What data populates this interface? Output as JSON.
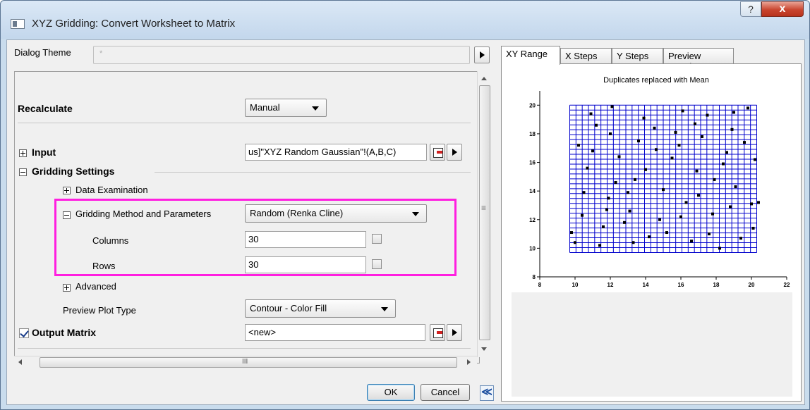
{
  "window": {
    "title": "XYZ Gridding: Convert Worksheet to Matrix",
    "help_label": "?",
    "close_label": "x"
  },
  "dialog_theme": {
    "label": "Dialog Theme",
    "value": "*"
  },
  "settings": {
    "recalculate": {
      "label": "Recalculate",
      "value": "Manual"
    },
    "input": {
      "label": "Input",
      "value": "us]\"XYZ Random Gaussian\"!(A,B,C)"
    },
    "gridding_settings": {
      "label": "Gridding Settings"
    },
    "data_examination": {
      "label": "Data Examination"
    },
    "gridding_method": {
      "label": "Gridding Method and Parameters",
      "value": "Random (Renka Cline)"
    },
    "columns": {
      "label": "Columns",
      "value": "30"
    },
    "rows": {
      "label": "Rows",
      "value": "30"
    },
    "advanced": {
      "label": "Advanced"
    },
    "preview_plot_type": {
      "label": "Preview Plot Type",
      "value": "Contour - Color Fill"
    },
    "output_matrix": {
      "label": "Output Matrix",
      "value": "<new>",
      "checked": true
    }
  },
  "scroll": {
    "h_thumb_glyph": "III",
    "v_thumb_glyph": "≡"
  },
  "buttons": {
    "ok": "OK",
    "cancel": "Cancel",
    "collapse": "≪"
  },
  "tabs": [
    "XY Range",
    "X Steps",
    "Y Steps",
    "Preview Result"
  ],
  "chart_data": {
    "type": "scatter",
    "title": "Duplicates replaced with Mean",
    "xlim": [
      8,
      22
    ],
    "ylim": [
      8,
      21
    ],
    "x_ticks": [
      8,
      10,
      12,
      14,
      16,
      18,
      20,
      22
    ],
    "y_ticks": [
      8,
      10,
      12,
      14,
      16,
      18,
      20
    ],
    "grid": {
      "x_from": 9.7,
      "x_to": 20.3,
      "y_from": 9.7,
      "y_to": 20.0,
      "columns": 30,
      "rows": 30
    },
    "grid_color": "#0000cc",
    "point_color": "#000000",
    "points": [
      [
        10.0,
        10.4
      ],
      [
        10.4,
        12.3
      ],
      [
        11.2,
        18.6
      ],
      [
        12.1,
        19.9
      ],
      [
        13.4,
        14.8
      ],
      [
        14.6,
        16.9
      ],
      [
        15.2,
        11.1
      ],
      [
        16.3,
        13.2
      ],
      [
        17.5,
        19.3
      ],
      [
        18.2,
        10.0
      ],
      [
        19.6,
        17.4
      ],
      [
        10.7,
        15.6
      ],
      [
        11.9,
        13.5
      ],
      [
        12.8,
        11.8
      ],
      [
        13.9,
        19.1
      ],
      [
        15.7,
        18.1
      ],
      [
        16.9,
        15.4
      ],
      [
        17.8,
        12.4
      ],
      [
        19.1,
        14.3
      ],
      [
        20.1,
        11.4
      ],
      [
        10.2,
        17.2
      ],
      [
        11.4,
        10.2
      ],
      [
        12.5,
        16.4
      ],
      [
        13.1,
        12.6
      ],
      [
        14.2,
        10.8
      ],
      [
        15.0,
        14.1
      ],
      [
        16.1,
        19.6
      ],
      [
        17.2,
        17.8
      ],
      [
        18.4,
        15.9
      ],
      [
        19.8,
        19.8
      ],
      [
        10.9,
        19.4
      ],
      [
        12.3,
        14.6
      ],
      [
        14.8,
        12.0
      ],
      [
        16.6,
        10.5
      ],
      [
        18.8,
        12.9
      ],
      [
        20.2,
        16.2
      ],
      [
        11.6,
        11.5
      ],
      [
        13.6,
        17.5
      ],
      [
        15.5,
        16.3
      ],
      [
        17.0,
        13.7
      ],
      [
        18.9,
        18.3
      ],
      [
        10.5,
        13.9
      ],
      [
        19.4,
        10.7
      ],
      [
        14.0,
        15.5
      ],
      [
        16.0,
        12.2
      ],
      [
        12.0,
        18.0
      ],
      [
        17.6,
        11.0
      ],
      [
        15.9,
        17.2
      ],
      [
        20.0,
        13.1
      ],
      [
        11.0,
        16.8
      ],
      [
        13.3,
        10.4
      ],
      [
        18.6,
        16.7
      ],
      [
        9.8,
        11.1
      ],
      [
        20.4,
        13.2
      ],
      [
        13.0,
        13.9
      ],
      [
        16.8,
        18.7
      ],
      [
        19.0,
        19.5
      ],
      [
        11.8,
        12.7
      ],
      [
        14.5,
        18.4
      ],
      [
        17.9,
        14.8
      ]
    ]
  }
}
